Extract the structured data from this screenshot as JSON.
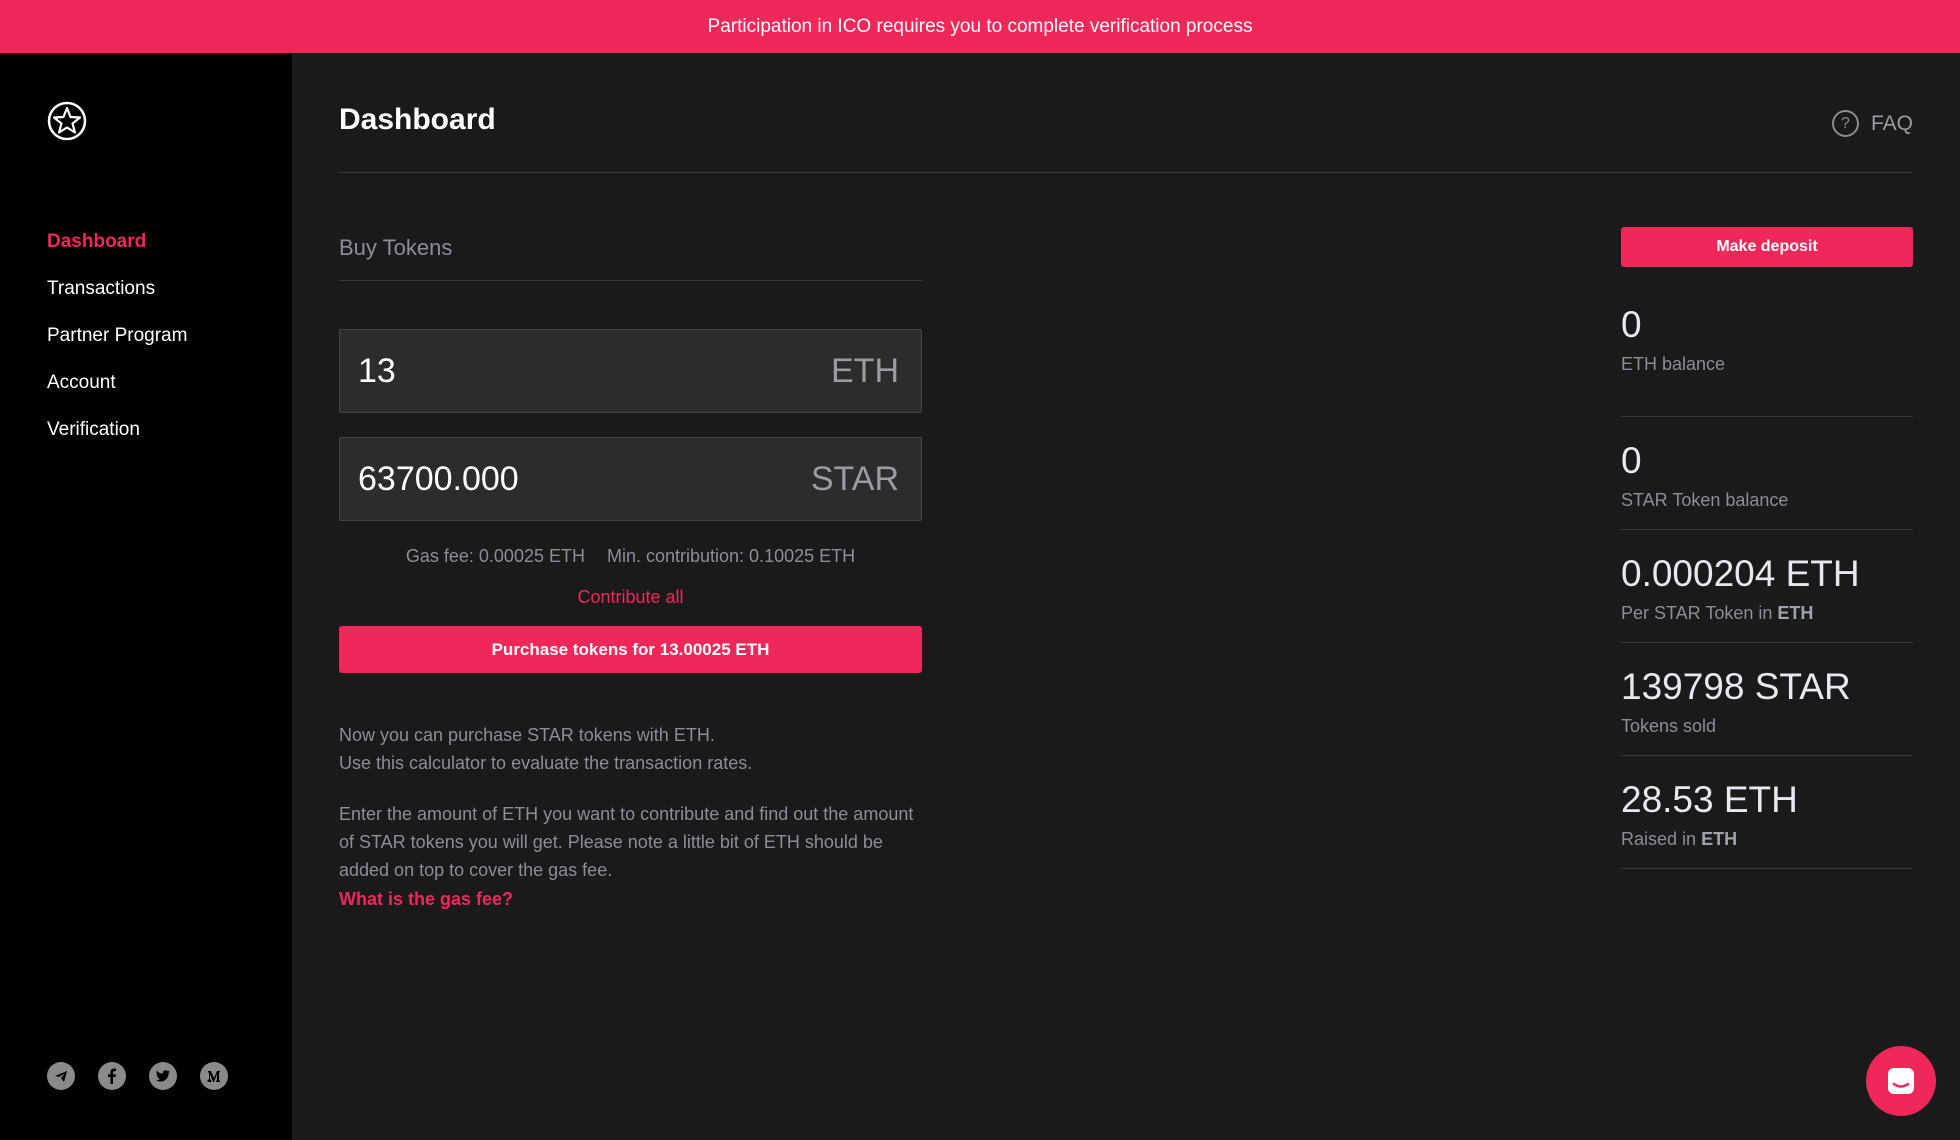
{
  "banner": {
    "text": "Participation in ICO requires you to complete verification process"
  },
  "sidebar": {
    "items": [
      {
        "label": "Dashboard",
        "active": true
      },
      {
        "label": "Transactions"
      },
      {
        "label": "Partner Program"
      },
      {
        "label": "Account"
      },
      {
        "label": "Verification"
      }
    ],
    "socials": [
      "telegram-icon",
      "facebook-icon",
      "twitter-icon",
      "medium-icon"
    ]
  },
  "header": {
    "title": "Dashboard",
    "faq_label": "FAQ",
    "faq_icon_glyph": "?"
  },
  "buy": {
    "title": "Buy Tokens",
    "eth_value": "13",
    "eth_unit": "ETH",
    "star_value": "63700.000",
    "star_unit": "STAR",
    "gas_fee": "Gas fee: 0.00025 ETH",
    "min_contribution": "Min. contribution: 0.10025 ETH",
    "contribute_all": "Contribute all",
    "purchase_label": "Purchase tokens for 13.00025 ETH",
    "desc_line1": "Now you can purchase STAR tokens with ETH.",
    "desc_line2": "Use this calculator to evaluate the transaction rates.",
    "desc_para2": "Enter the amount of ETH you want to contribute and find out the amount of STAR tokens you will get. Please note a little bit of ETH should be added on top to cover the gas fee.",
    "gas_link": "What is the gas fee?"
  },
  "stats": {
    "deposit_label": "Make deposit",
    "eth_balance": {
      "value": "0",
      "label": "ETH balance"
    },
    "star_balance": {
      "value": "0",
      "label": "STAR Token balance"
    },
    "price": {
      "value": "0.000204 ETH",
      "label": "Per STAR Token in",
      "label_bold": "ETH"
    },
    "sold": {
      "value": "139798 STAR",
      "label": "Tokens sold"
    },
    "raised": {
      "value": "28.53 ETH",
      "label": "Raised in",
      "label_bold": "ETH"
    }
  },
  "colors": {
    "accent": "#f0285a",
    "background": "#1a1a1a",
    "sidebar": "#000000"
  }
}
